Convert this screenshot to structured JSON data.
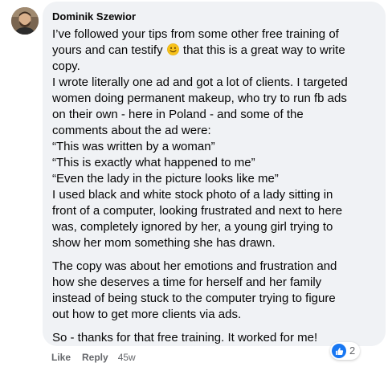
{
  "comment": {
    "author": "Dominik Szewior",
    "body": {
      "p1": {
        "l1": "I’ve followed your tips from some other free training of",
        "l2a": "yours and can testify",
        "l2b": "that this is a great way to write",
        "l3": "copy.",
        "l4": "I wrote literally one ad and got a lot of clients. I targeted",
        "l5": "women doing permanent makeup, who try to run fb ads",
        "l6": "on their own - here in Poland - and some of the",
        "l7": "comments about the ad were:",
        "l8": "“This was written by a woman”",
        "l9": "“This is exactly what happened to me”",
        "l10": "“Even the lady in the picture looks like me”",
        "l11": "I used black and white stock photo of a lady sitting in",
        "l12": "front of a computer, looking frustrated and next to here",
        "l13": "was, completely ignored by her, a young girl trying to",
        "l14": "show her mom something she has drawn."
      },
      "p2": {
        "l1": "The copy was about her emotions and frustration and",
        "l2": "how she deserves a time for herself and her family",
        "l3": "instead of being stuck to the computer trying to figure",
        "l4": "out how to get more clients via ads."
      },
      "p3": {
        "l1": "So - thanks for that free training. It worked for me!"
      }
    },
    "emoji": "smiling-face-icon",
    "actions": {
      "like": "Like",
      "reply": "Reply",
      "time": "45w"
    },
    "reactions": {
      "icon": "like-icon",
      "count": "2",
      "color": "#1877f2"
    }
  }
}
